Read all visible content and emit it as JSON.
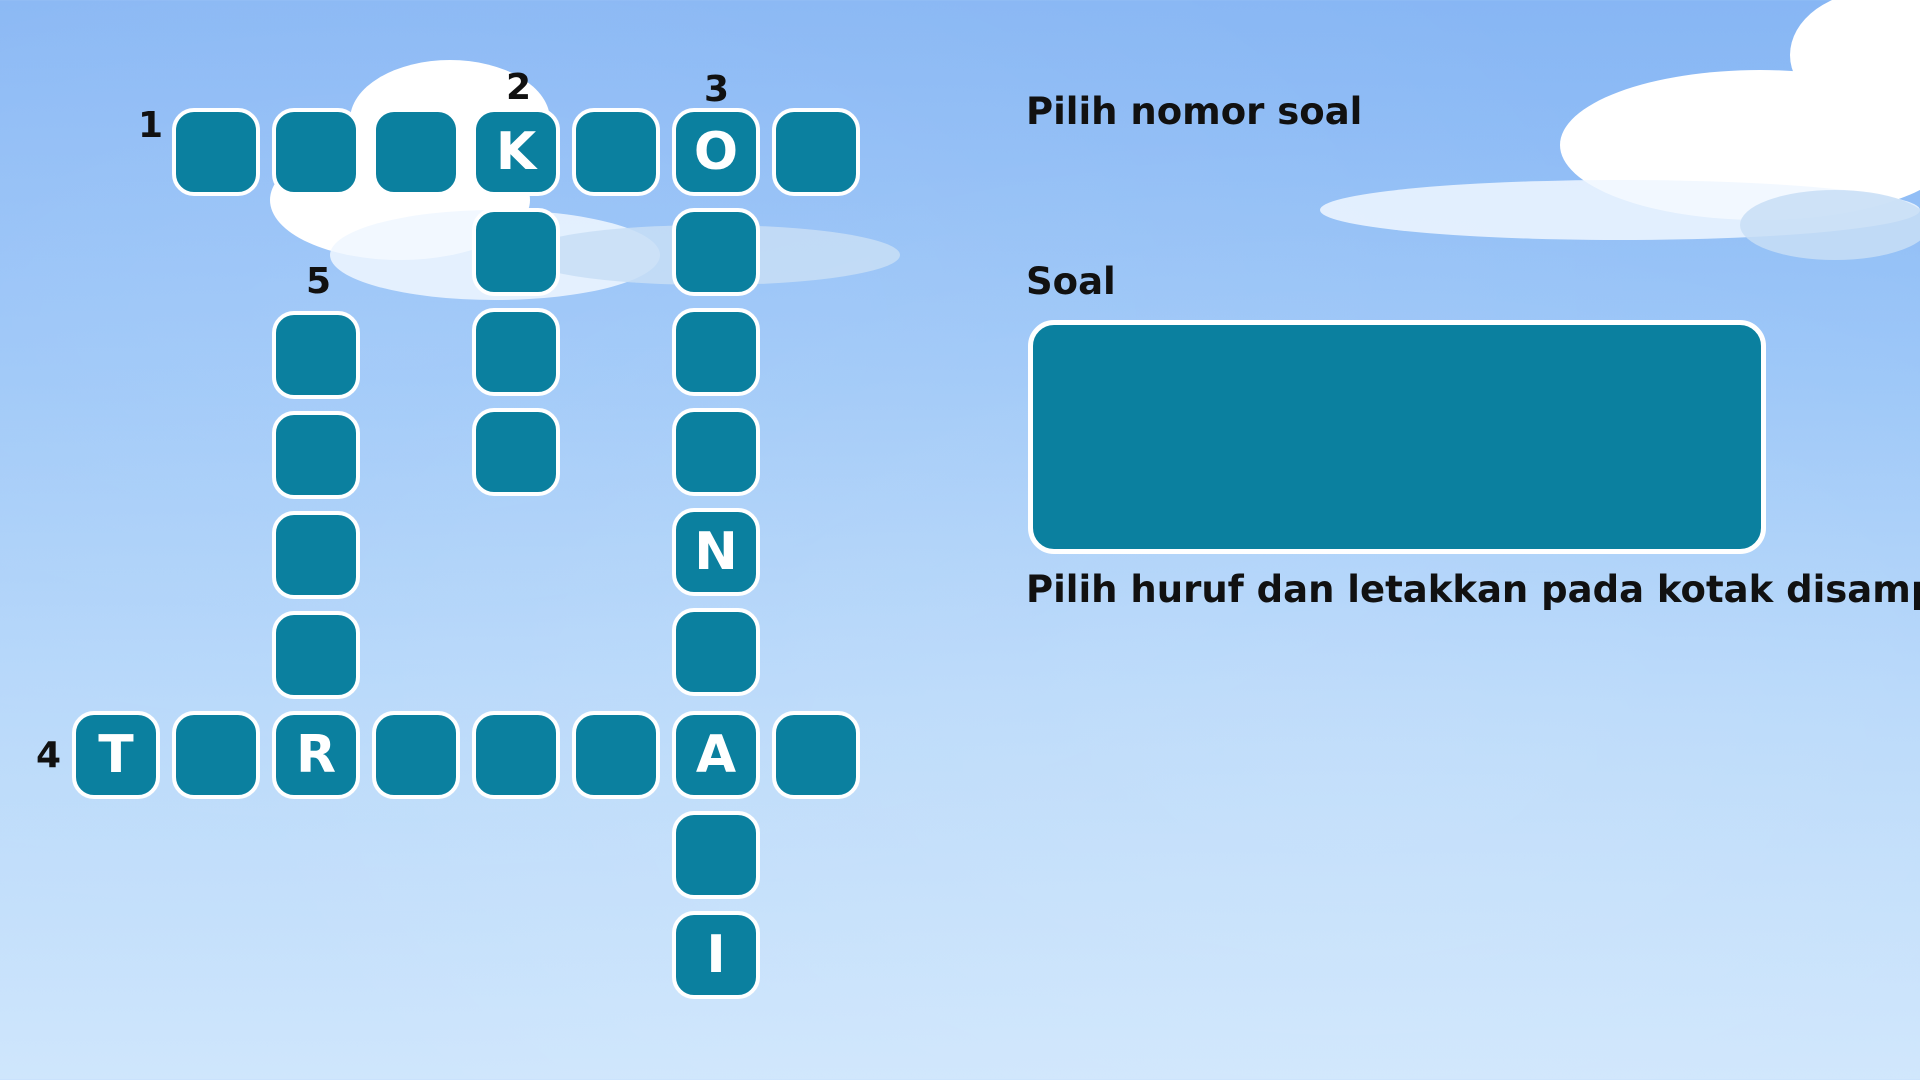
{
  "numbers": [
    "1",
    "2",
    "3",
    "4",
    "5"
  ],
  "cells": {
    "row1": [
      "",
      "",
      "",
      "K",
      "",
      "O",
      ""
    ],
    "col2": [
      "",
      "",
      ""
    ],
    "col3": [
      "",
      "",
      "",
      "N",
      "",
      "A",
      "",
      "I"
    ],
    "col5": [
      "",
      "",
      "",
      "",
      "R"
    ],
    "row4": [
      "T",
      "",
      "",
      "",
      "",
      ""
    ]
  },
  "panel": {
    "choose_number_label": "Pilih nomor soal",
    "question_label": "Soal",
    "question_text": "",
    "instruction": "Pilih huruf dan letakkan pada kotak disamping"
  },
  "colors": {
    "cell_fill": "#0b809f",
    "cell_border": "#ffffff",
    "sky_top": "#87b6f4",
    "sky_bottom": "#cfe6fc"
  }
}
